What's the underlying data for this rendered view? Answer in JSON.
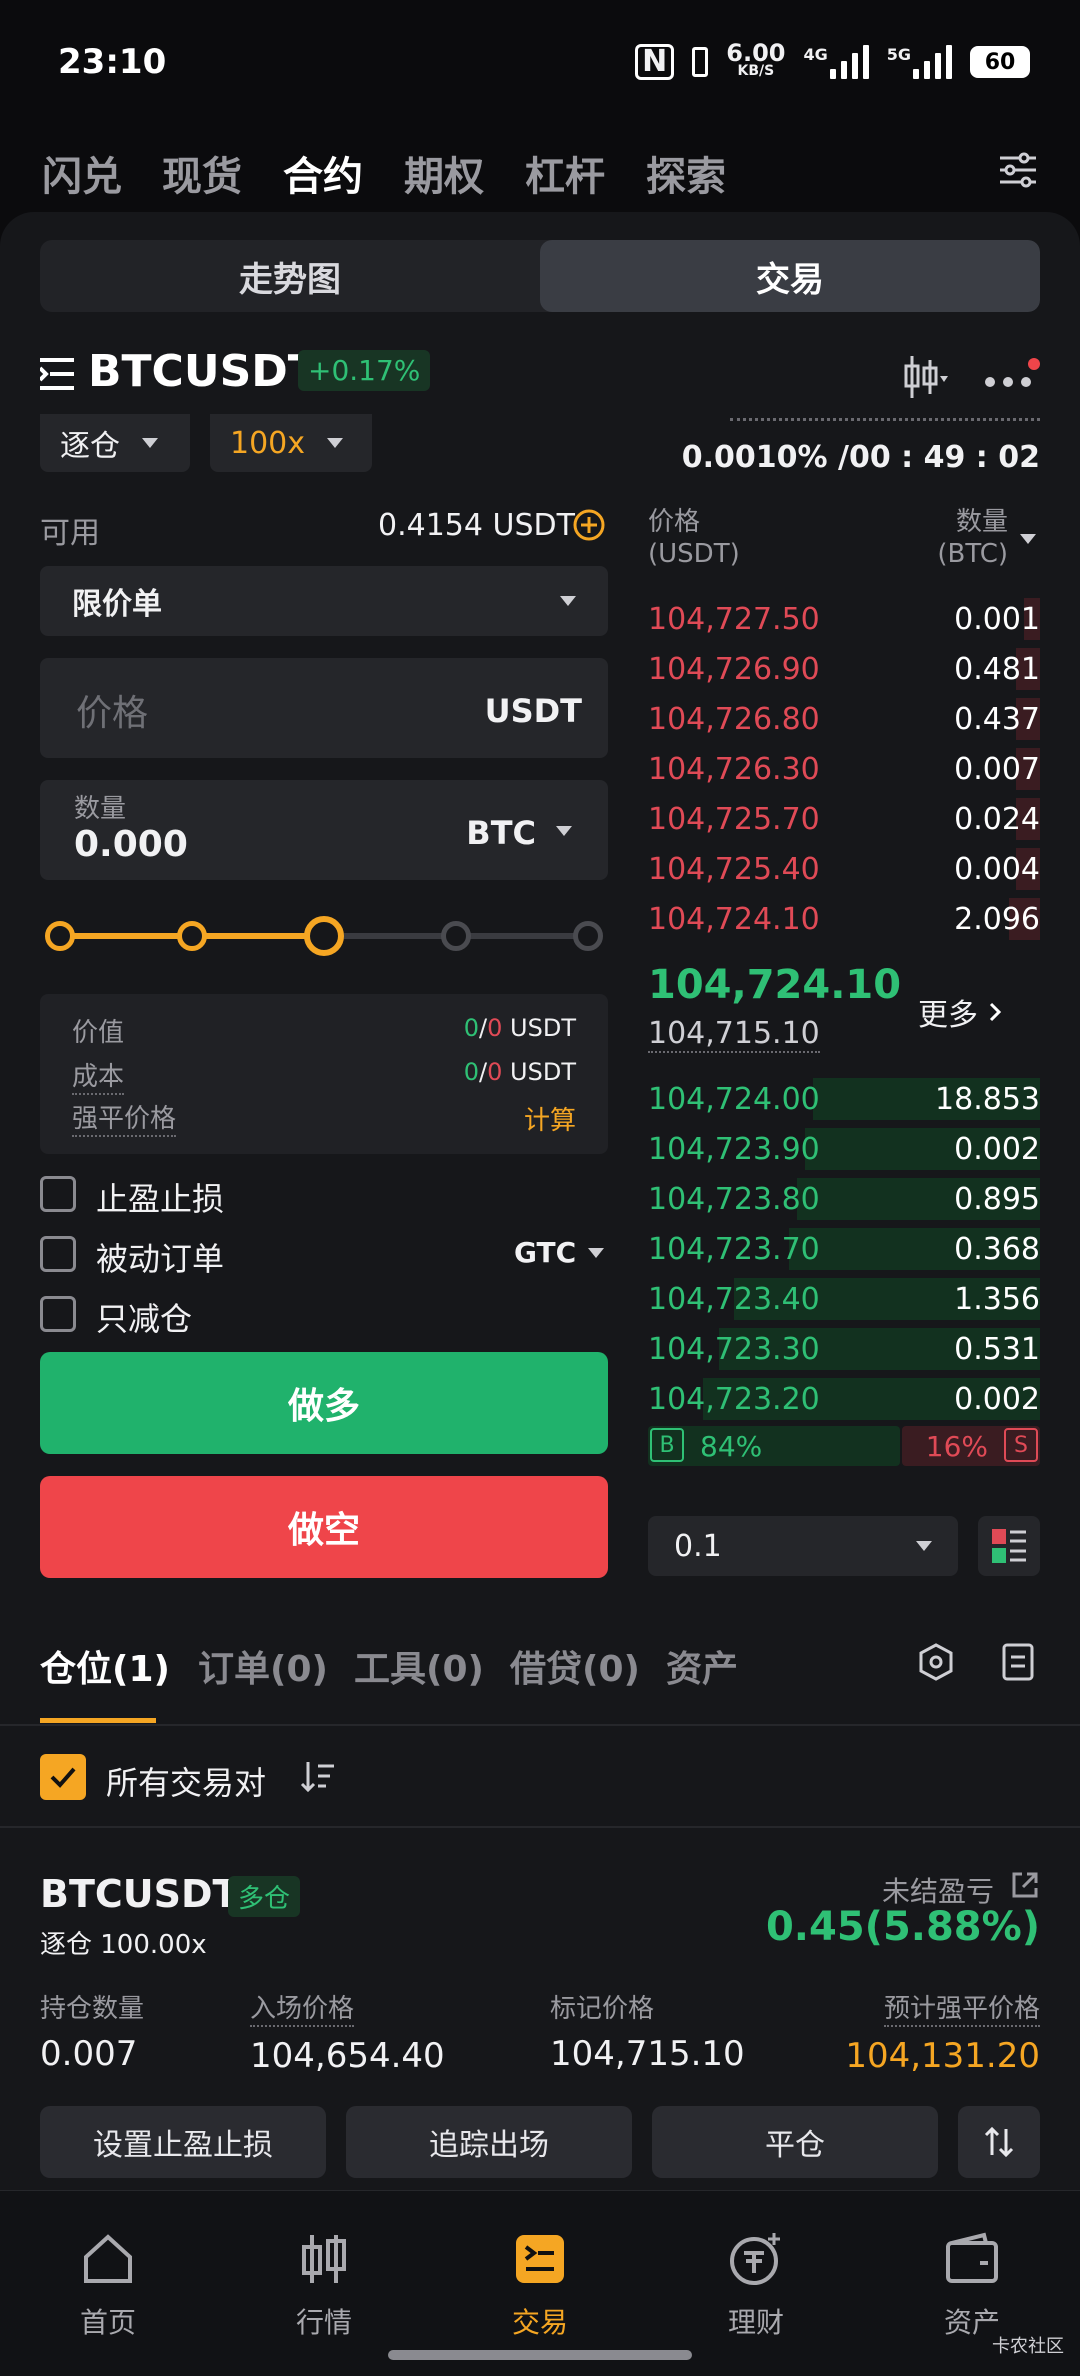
{
  "status": {
    "time": "23:10",
    "net_speed_top": "6.00",
    "net_speed_unit": "KB/S",
    "sig1": "4G",
    "sig2": "5G",
    "battery": "60"
  },
  "top_nav": [
    "闪兑",
    "现货",
    "合约",
    "期权",
    "杠杆",
    "探索"
  ],
  "top_nav_active": "合约",
  "seg": {
    "chart": "走势图",
    "trade": "交易"
  },
  "pair": {
    "name": "BTCUSDT",
    "change": "+0.17%"
  },
  "margin_mode": "逐仓",
  "leverage": "100x",
  "funding": "0.0010% /00 : 49 : 02",
  "available": {
    "label": "可用",
    "value": "0.4154 USDT"
  },
  "order_type": "限价单",
  "price_field": {
    "placeholder": "价格",
    "unit": "USDT"
  },
  "qty_field": {
    "label": "数量",
    "value": "0.000",
    "unit": "BTC"
  },
  "slider_level": 0.5,
  "summary": {
    "value_label": "价值",
    "value_g": "0",
    "value_sep": "/",
    "value_r": "0",
    "value_unit": " USDT",
    "cost_label": "成本",
    "cost_g": "0",
    "cost_sep": "/",
    "cost_r": "0",
    "cost_unit": " USDT",
    "liq_label": "强平价格",
    "liq_action": "计算"
  },
  "options": {
    "tpsl": "止盈止损",
    "post_only": "被动订单",
    "tif": "GTC",
    "reduce_only": "只减仓"
  },
  "buttons": {
    "long": "做多",
    "short": "做空"
  },
  "orderbook": {
    "header_price": "价格",
    "header_price_unit": "(USDT)",
    "header_qty": "数量",
    "header_qty_unit": "(BTC)",
    "asks": [
      {
        "price": "104,727.50",
        "qty": "0.001",
        "depth": 0.04
      },
      {
        "price": "104,726.90",
        "qty": "0.481",
        "depth": 0.06
      },
      {
        "price": "104,726.80",
        "qty": "0.437",
        "depth": 0.06
      },
      {
        "price": "104,726.30",
        "qty": "0.007",
        "depth": 0.06
      },
      {
        "price": "104,725.70",
        "qty": "0.024",
        "depth": 0.06
      },
      {
        "price": "104,725.40",
        "qty": "0.004",
        "depth": 0.06
      },
      {
        "price": "104,724.10",
        "qty": "2.096",
        "depth": 0.08
      }
    ],
    "last_price": "104,724.10",
    "mark_price": "104,715.10",
    "more": "更多",
    "bids": [
      {
        "price": "104,724.00",
        "qty": "18.853",
        "depth": 0.58
      },
      {
        "price": "104,723.90",
        "qty": "0.002",
        "depth": 0.6
      },
      {
        "price": "104,723.80",
        "qty": "0.895",
        "depth": 0.62
      },
      {
        "price": "104,723.70",
        "qty": "0.368",
        "depth": 0.64
      },
      {
        "price": "104,723.40",
        "qty": "1.356",
        "depth": 0.78
      },
      {
        "price": "104,723.30",
        "qty": "0.531",
        "depth": 0.82
      },
      {
        "price": "104,723.20",
        "qty": "0.002",
        "depth": 0.86
      }
    ],
    "buy_label": "B",
    "buy_pct": "84%",
    "sell_pct": "16%",
    "sell_label": "S",
    "precision": "0.1"
  },
  "tabs": [
    "仓位(1)",
    "订单(0)",
    "工具(0)",
    "借贷(0)",
    "资产"
  ],
  "filter": {
    "all_pairs": "所有交易对"
  },
  "position": {
    "pair": "BTCUSDT",
    "side": "多仓",
    "mode": "逐仓 100.00x",
    "pnl_label": "未结盈亏",
    "pnl_value": "0.45(5.88%)",
    "size_label": "持仓数量",
    "size": "0.007",
    "entry_label": "入场价格",
    "entry": "104,654.40",
    "mark_label": "标记价格",
    "mark": "104,715.10",
    "liq_label": "预计强平价格",
    "liq": "104,131.20",
    "btn_tpsl": "设置止盈止损",
    "btn_trailing": "追踪出场",
    "btn_close": "平仓"
  },
  "bottom_nav": [
    "首页",
    "行情",
    "交易",
    "理财",
    "资产"
  ],
  "bottom_nav_active": "交易",
  "watermark": "卡农社区",
  "colors": {
    "accent": "#f5a623",
    "green": "#2fc075",
    "red": "#e04a56",
    "long_btn": "#20b26c",
    "short_btn": "#ef454a"
  }
}
